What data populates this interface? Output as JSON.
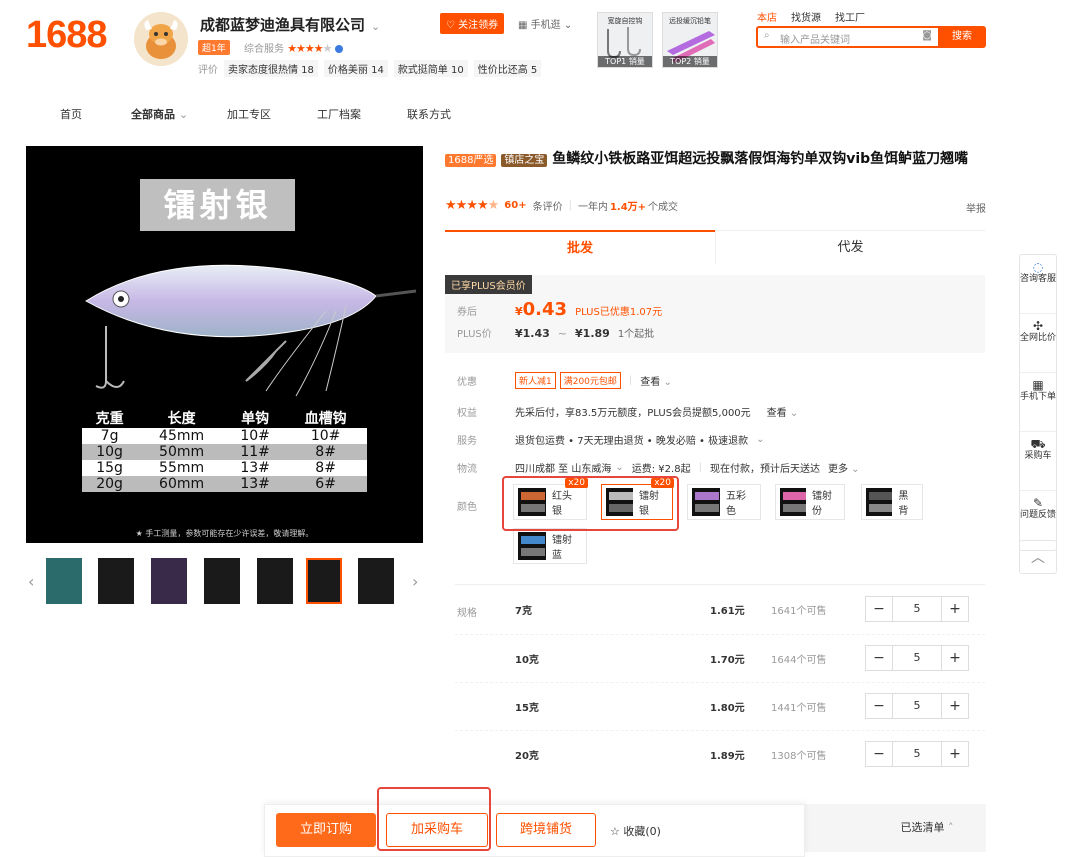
{
  "header": {
    "logo": "1688",
    "shop_name": "成都蓝梦迪渔具有限公司",
    "year_tag": "超1年",
    "service_label": "综合服务",
    "service_stars": 4,
    "follow_label": "关注领券",
    "mobile_label": "手机逛",
    "review_label": "评价",
    "review_tags": [
      "卖家态度很热情 18",
      "价格美丽 14",
      "款式挺简单 10",
      "性价比还高 5"
    ],
    "top_thumbs": [
      {
        "label": "TOP1 销量",
        "img_text": "宽旋自控钩"
      },
      {
        "label": "TOP2 销量",
        "img_text": "远投缓沉铅笔"
      }
    ],
    "links": [
      "本店",
      "找货源",
      "找工厂"
    ],
    "search_placeholder": "输入产品关键词",
    "search_button": "搜索"
  },
  "nav": [
    "首页",
    "全部商品",
    "加工专区",
    "工厂档案",
    "联系方式"
  ],
  "gallery": {
    "main_label": "镭射银",
    "table_headers": [
      "克重",
      "长度",
      "单钩",
      "血槽钩"
    ],
    "table_rows": [
      [
        "7g",
        "45mm",
        "10#",
        "10#"
      ],
      [
        "10g",
        "50mm",
        "11#",
        "8#"
      ],
      [
        "15g",
        "55mm",
        "13#",
        "8#"
      ],
      [
        "20g",
        "60mm",
        "13#",
        "6#"
      ]
    ],
    "footnote": "★ 手工测量，参数可能存在少许误差，敬请理解。",
    "prev": "‹",
    "next": "›"
  },
  "product": {
    "badge1": "1688严选",
    "badge2": "镇店之宝",
    "title": "鱼鳞纹小铁板路亚饵超远投飘落假饵海钓单双钩vib鱼饵鲈蓝刀翘嘴",
    "rating": 4.5,
    "review_count": "60+",
    "review_suffix": "条评价",
    "sales_prefix": "一年内",
    "sales_count": "1.4万+",
    "sales_suffix": "个成交",
    "report": "举报"
  },
  "tabs": [
    "批发",
    "代发"
  ],
  "price": {
    "plus_tag": "已享PLUS会员价",
    "coupon_label": "券后",
    "currency": "¥",
    "coupon_price": "0.43",
    "plus_discount": "PLUS已优惠1.07元",
    "plus_label": "PLUS价",
    "plus_low": "1.43",
    "tilde": "~",
    "plus_high": "1.89",
    "moq": "1个起批"
  },
  "info": {
    "promo_label": "优惠",
    "promo_tags": [
      "新人减1",
      "满200元包邮"
    ],
    "view": "查看",
    "rights_label": "权益",
    "rights_text": "先采后付，享83.5万元额度，PLUS会员提额5,000元",
    "service_label": "服务",
    "service_text": "退货包运费 • 7天无理由退货 • 晚发必赔 • 极速退款",
    "logistics_label": "物流",
    "logistics_text": "四川成都 至 山东威海",
    "freight": "运费: ¥2.8起",
    "ship_text": "现在付款，预计后天送达",
    "more": "更多",
    "color_label": "颜色"
  },
  "colors": [
    {
      "name": "红头银",
      "badge": "x20"
    },
    {
      "name": "镭射银",
      "badge": "x20"
    },
    {
      "name": "五彩色",
      "badge": ""
    },
    {
      "name": "镭射份",
      "badge": ""
    },
    {
      "name": "黑背",
      "badge": ""
    },
    {
      "name": "镭射蓝",
      "badge": ""
    }
  ],
  "spec_label": "规格",
  "specs": [
    {
      "name": "7克",
      "price": "1.61元",
      "stock": "1641个可售",
      "qty": "5"
    },
    {
      "name": "10克",
      "price": "1.70元",
      "stock": "1644个可售",
      "qty": "5"
    },
    {
      "name": "15克",
      "price": "1.80元",
      "stock": "1441个可售",
      "qty": "5"
    },
    {
      "name": "20克",
      "price": "1.89元",
      "stock": "1308个可售",
      "qty": "5"
    }
  ],
  "side_panel": [
    "咨询客服",
    "全网比价",
    "手机下单",
    "采购车",
    "问题反馈"
  ],
  "bottom": {
    "order": "立即订购",
    "cart": "加采购车",
    "cross": "跨境铺货",
    "fav": "收藏(0)",
    "selected": "已选清单"
  },
  "colors_theme": {
    "accent": "#ff5000",
    "highlight": "#e8453c"
  }
}
